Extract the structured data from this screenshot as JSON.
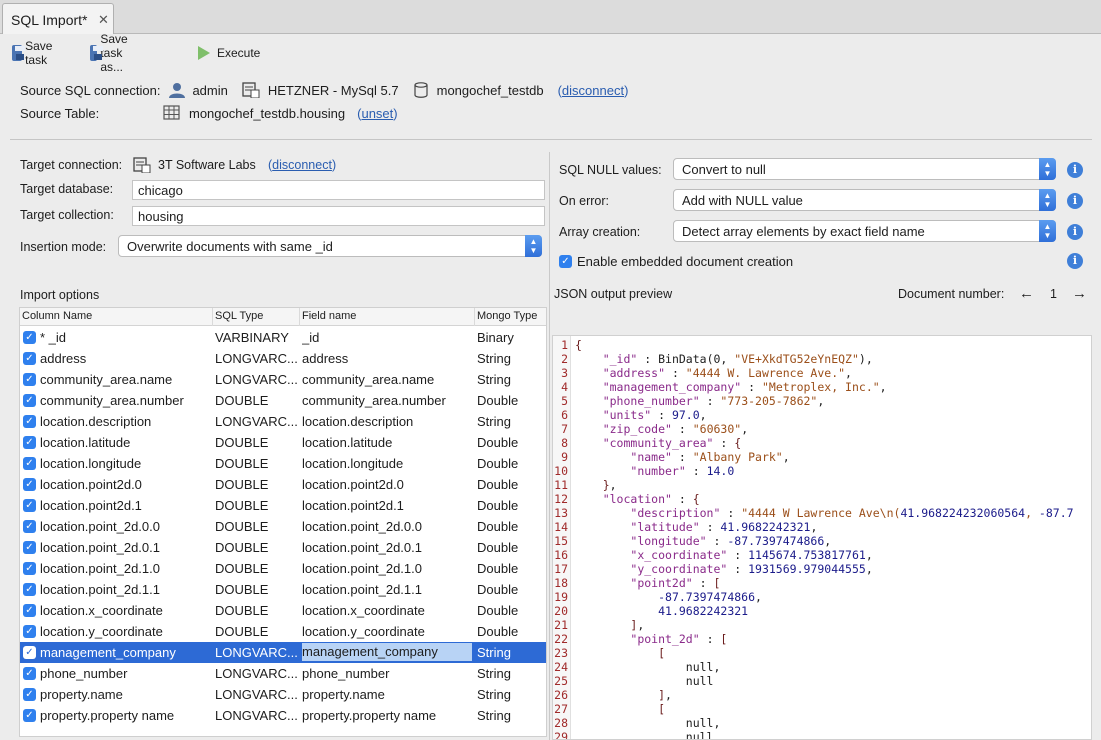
{
  "tab": {
    "title": "SQL Import*",
    "close": "✕"
  },
  "toolbar": {
    "save_task": "Save task",
    "save_task_as": "Save task as...",
    "execute": "Execute"
  },
  "source": {
    "connection_label": "Source SQL connection:",
    "user": "admin",
    "server": "HETZNER - MySql 5.7",
    "database": "mongochef_testdb",
    "disconnect": "disconnect",
    "table_label": "Source Table:",
    "table": "mongochef_testdb.housing",
    "unset": "unset"
  },
  "target": {
    "connection_label": "Target connection:",
    "connection": "3T Software Labs",
    "disconnect": "disconnect",
    "database_label": "Target database:",
    "database": "chicago",
    "collection_label": "Target collection:",
    "collection": "housing",
    "insertion_label": "Insertion mode:",
    "insertion": "Overwrite documents with same _id"
  },
  "options": {
    "null_label": "SQL NULL values:",
    "null_value": "Convert to null",
    "error_label": "On error:",
    "error_value": "Add with NULL value",
    "array_label": "Array creation:",
    "array_value": "Detect array elements by exact field name",
    "embedded_label": "Enable embedded document creation"
  },
  "import_options": {
    "title": "Import options",
    "headers": [
      "Column Name",
      "SQL Type",
      "Field name",
      "Mongo Type"
    ],
    "rows": [
      [
        "* _id",
        "VARBINARY",
        "_id",
        "Binary"
      ],
      [
        "address",
        "LONGVARC...",
        "address",
        "String"
      ],
      [
        "community_area.name",
        "LONGVARC...",
        "community_area.name",
        "String"
      ],
      [
        "community_area.number",
        "DOUBLE",
        "community_area.number",
        "Double"
      ],
      [
        "location.description",
        "LONGVARC...",
        "location.description",
        "String"
      ],
      [
        "location.latitude",
        "DOUBLE",
        "location.latitude",
        "Double"
      ],
      [
        "location.longitude",
        "DOUBLE",
        "location.longitude",
        "Double"
      ],
      [
        "location.point2d.0",
        "DOUBLE",
        "location.point2d.0",
        "Double"
      ],
      [
        "location.point2d.1",
        "DOUBLE",
        "location.point2d.1",
        "Double"
      ],
      [
        "location.point_2d.0.0",
        "DOUBLE",
        "location.point_2d.0.0",
        "Double"
      ],
      [
        "location.point_2d.0.1",
        "DOUBLE",
        "location.point_2d.0.1",
        "Double"
      ],
      [
        "location.point_2d.1.0",
        "DOUBLE",
        "location.point_2d.1.0",
        "Double"
      ],
      [
        "location.point_2d.1.1",
        "DOUBLE",
        "location.point_2d.1.1",
        "Double"
      ],
      [
        "location.x_coordinate",
        "DOUBLE",
        "location.x_coordinate",
        "Double"
      ],
      [
        "location.y_coordinate",
        "DOUBLE",
        "location.y_coordinate",
        "Double"
      ],
      [
        "management_company",
        "LONGVARC...",
        "management_company",
        "String"
      ],
      [
        "phone_number",
        "LONGVARC...",
        "phone_number",
        "String"
      ],
      [
        "property.name",
        "LONGVARC...",
        "property.name",
        "String"
      ],
      [
        "property.property name",
        "LONGVARC...",
        "property.property name",
        "String"
      ]
    ],
    "selected_row": 15
  },
  "preview": {
    "title": "JSON output preview",
    "doc_label": "Document number:",
    "prev": "←",
    "doc_number": "1",
    "next": "→",
    "lines": [
      "{",
      "    \"_id\" : BinData(0, \"VE+XkdTG52eYnEQZ\"),",
      "    \"address\" : \"4444 W. Lawrence Ave.\",",
      "    \"management_company\" : \"Metroplex, Inc.\",",
      "    \"phone_number\" : \"773-205-7862\",",
      "    \"units\" : 97.0,",
      "    \"zip_code\" : \"60630\",",
      "    \"community_area\" : {",
      "        \"name\" : \"Albany Park\",",
      "        \"number\" : 14.0",
      "    },",
      "    \"location\" : {",
      "        \"description\" : \"4444 W Lawrence Ave\\n(41.968224232060564, -87.7",
      "        \"latitude\" : 41.9682242321,",
      "        \"longitude\" : -87.7397474866,",
      "        \"x_coordinate\" : 1145674.753817761,",
      "        \"y_coordinate\" : 1931569.979044555,",
      "        \"point2d\" : [",
      "            -87.7397474866,",
      "            41.9682242321",
      "        ],",
      "        \"point_2d\" : [",
      "            [",
      "                null,",
      "                null",
      "            ],",
      "            [",
      "                null,",
      "                null"
    ]
  }
}
